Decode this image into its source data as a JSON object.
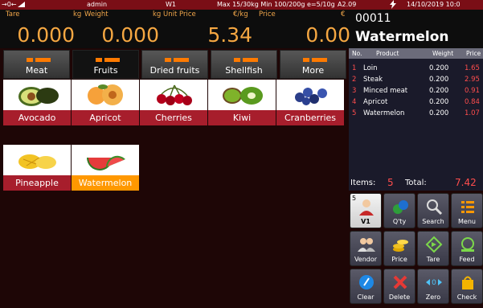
{
  "status": {
    "arrows": "→0←",
    "user": "admin",
    "device": "W1",
    "range": "Max 15/30kg  Min 100/200g e=5/10g",
    "code": "A2.09",
    "datetime": "14/10/2019 10:0"
  },
  "display": {
    "tare_label": "Tare",
    "tare_unit": "kg",
    "weight_label": "Weight",
    "weight_unit": "kg",
    "unitprice_label": "Unit Price",
    "unitprice_unit": "€/kg",
    "price_label": "Price",
    "price_unit": "€",
    "tare": "0.000",
    "weight": "0.000",
    "unit_price": "5.34",
    "price": "0.00"
  },
  "product": {
    "code": "00011",
    "name": "Watermelon"
  },
  "categories": [
    {
      "label": "Meat"
    },
    {
      "label": "Fruits"
    },
    {
      "label": "Dried fruits"
    },
    {
      "label": "Shellfish"
    },
    {
      "label": "More"
    }
  ],
  "items": [
    {
      "label": "Avocado"
    },
    {
      "label": "Apricot"
    },
    {
      "label": "Cherries"
    },
    {
      "label": "Kiwi"
    },
    {
      "label": "Cranberries"
    },
    {
      "label": "Pineapple"
    },
    {
      "label": "Watermelon"
    }
  ],
  "list": {
    "headers": [
      "No.",
      "Product",
      "Weight",
      "Price"
    ],
    "rows": [
      {
        "no": "1",
        "product": "Loin",
        "weight": "0.200",
        "price": "1.65"
      },
      {
        "no": "2",
        "product": "Steak",
        "weight": "0.200",
        "price": "2.95"
      },
      {
        "no": "3",
        "product": "Minced meat",
        "weight": "0.200",
        "price": "0.91"
      },
      {
        "no": "4",
        "product": "Apricot",
        "weight": "0.200",
        "price": "0.84"
      },
      {
        "no": "5",
        "product": "Watermelon",
        "weight": "0.200",
        "price": "1.07"
      }
    ]
  },
  "totals": {
    "items_label": "Items:",
    "items": "5",
    "total_label": "Total:",
    "total": "7.42"
  },
  "buttons": [
    {
      "label": "V1",
      "icon": "user-icon",
      "count": "5"
    },
    {
      "label": "Q'ty",
      "icon": "qty-icon"
    },
    {
      "label": "Search",
      "icon": "search-icon"
    },
    {
      "label": "Menu",
      "icon": "menu-icon"
    },
    {
      "label": "Vendor",
      "icon": "vendor-icon"
    },
    {
      "label": "Price",
      "icon": "coins-icon"
    },
    {
      "label": "Tare",
      "icon": "tare-icon"
    },
    {
      "label": "Feed",
      "icon": "feed-icon"
    },
    {
      "label": "Clear",
      "icon": "clear-icon"
    },
    {
      "label": "Delete",
      "icon": "delete-icon"
    },
    {
      "label": "Zero",
      "icon": "zero-icon"
    },
    {
      "label": "Check",
      "icon": "check-icon"
    }
  ],
  "colors": {
    "accent": "#ff9800",
    "item_bar": "#a71e2c",
    "status_bar": "#7a0e16",
    "display_digits": "#f5a742",
    "row_index": "#ff4d4d"
  }
}
